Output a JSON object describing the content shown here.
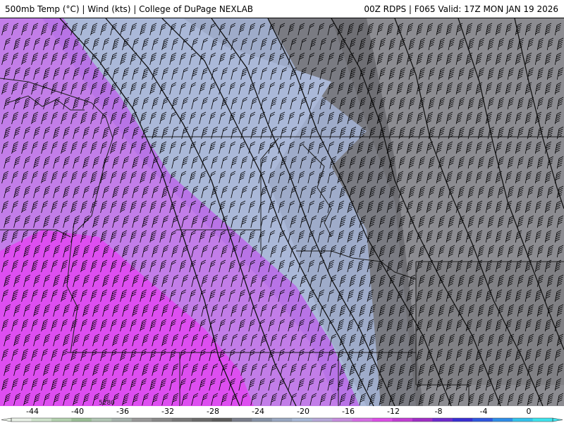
{
  "header": {
    "left": "500mb Temp (°C) | Wind (kts) | College of DuPage NEXLAB",
    "right": "00Z RDPS | F065 Valid: 17Z MON JAN 19 2026"
  },
  "map": {
    "height_label": "5280"
  },
  "colorbar": {
    "ticks": [
      "-44",
      "-40",
      "-36",
      "-32",
      "-28",
      "-24",
      "-20",
      "-16",
      "-12",
      "-8",
      "-4",
      "0"
    ],
    "colors": [
      "#e8f0e6",
      "#cfe3cc",
      "#b4d2b0",
      "#9cbf98",
      "#b3c7b6",
      "#a7b3ad",
      "#9a9a9a",
      "#8a8a8a",
      "#7a7a7a",
      "#6c6c6c",
      "#5e5e5e",
      "#7b7f8c",
      "#8894a8",
      "#9aa8c2",
      "#a9b8d6",
      "#b7a9d9",
      "#c78fe0",
      "#d66fe6",
      "#dd4fe8",
      "#c43ed6",
      "#a12ec8",
      "#6f2bd0",
      "#3a2fd4",
      "#2f58e0",
      "#2f8ee8",
      "#35c4ec",
      "#40e4ee"
    ]
  }
}
